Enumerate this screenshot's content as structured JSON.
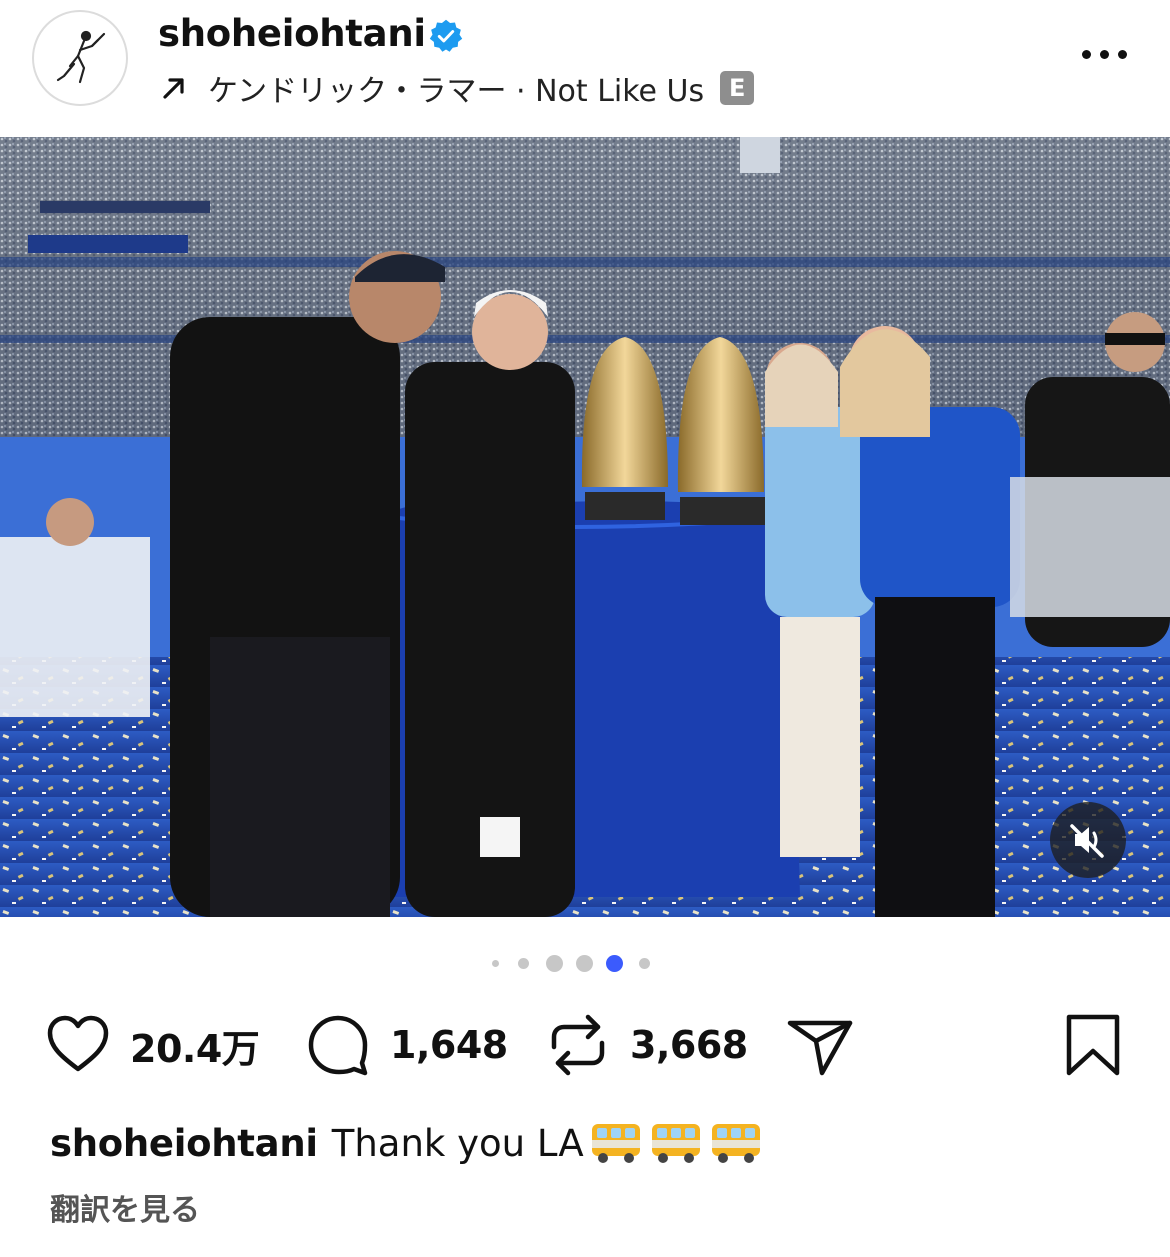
{
  "post": {
    "username": "shoheiohtani",
    "verified": true,
    "music": {
      "arrow_icon": "trending-arrow-icon",
      "text": "ケンドリック・ラマー · Not Like Us",
      "explicit_badge": "E"
    },
    "more_icon": "more-horizontal-icon"
  },
  "photo": {
    "alt_icon": "photo",
    "mute_icon": "speaker-muted-icon"
  },
  "carousel": {
    "count": 6,
    "active_index": 4
  },
  "actions": {
    "likes": "20.4万",
    "comments": "1,648",
    "reposts": "3,668",
    "like_icon": "heart-icon",
    "comment_icon": "comment-icon",
    "repost_icon": "repost-icon",
    "share_icon": "send-icon",
    "save_icon": "bookmark-icon"
  },
  "caption": {
    "username": "shoheiohtani",
    "text": "Thank you LA",
    "emoji_icon": "bus-emoji"
  },
  "translate_link": "翻訳を見る",
  "colors": {
    "verified": "#1d9bf0",
    "active_dot": "#3b5bfd",
    "inactive_dot": "#c7c7c7",
    "text": "#111111"
  }
}
